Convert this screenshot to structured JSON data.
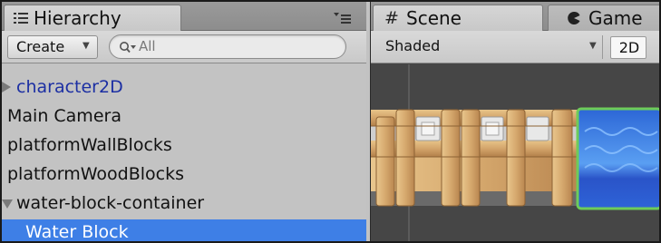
{
  "hierarchy": {
    "tab_label": "Hierarchy",
    "tab_icon": "list-icon",
    "menu_icon": "panel-menu-icon",
    "create_label": "Create",
    "search_placeholder": "All",
    "items": [
      {
        "label": "character2D",
        "expand": "collapsed",
        "prefab": true,
        "selected": false
      },
      {
        "label": "Main Camera",
        "expand": "none",
        "prefab": false,
        "selected": false
      },
      {
        "label": "platformWallBlocks",
        "expand": "none",
        "prefab": false,
        "selected": false
      },
      {
        "label": "platformWoodBlocks",
        "expand": "none",
        "prefab": false,
        "selected": false
      },
      {
        "label": "water-block-container",
        "expand": "expanded",
        "prefab": false,
        "selected": false
      },
      {
        "label": "Water Block",
        "expand": "none",
        "prefab": false,
        "selected": true
      }
    ]
  },
  "scene": {
    "tab_label": "Scene",
    "tab_icon": "hash-icon",
    "game_tab_label": "Game",
    "game_tab_icon": "pacman-icon",
    "shading_mode": "Shaded",
    "mode_2d_label": "2D"
  },
  "colors": {
    "selection": "#3e7fe6",
    "prefab_text": "#1c2fa3",
    "scene_background": "#464646",
    "water_outline": "#6dcc5a"
  }
}
